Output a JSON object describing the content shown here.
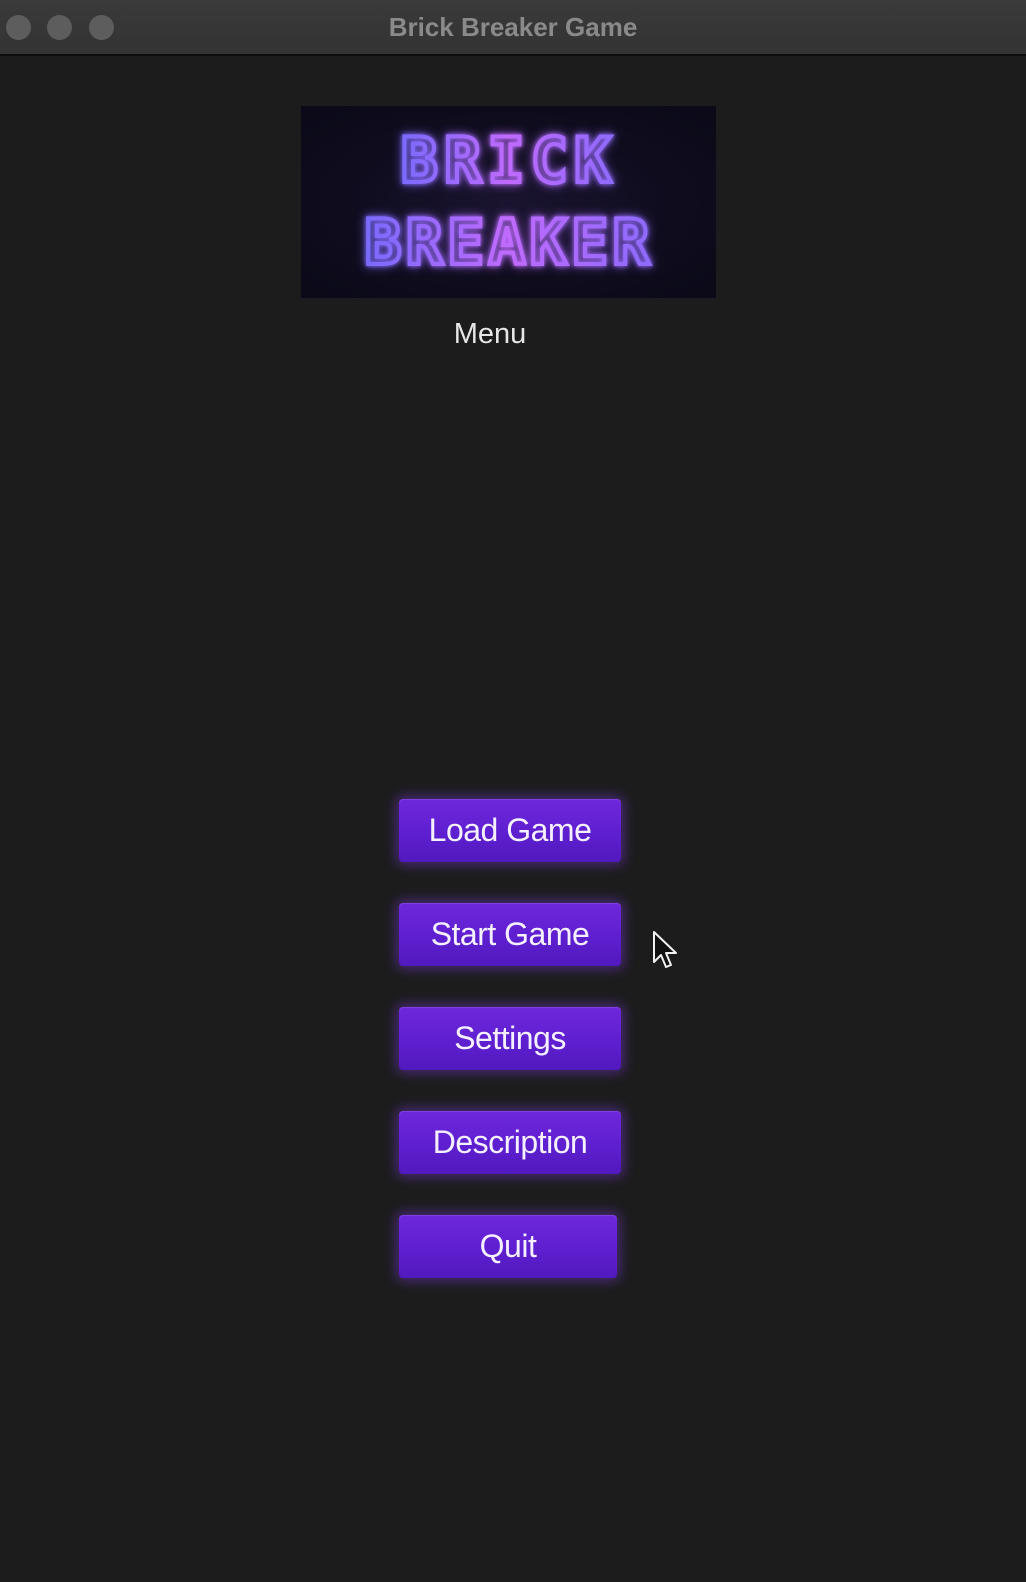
{
  "window": {
    "title": "Brick Breaker Game",
    "controls": [
      "close",
      "minimize",
      "zoom"
    ]
  },
  "logo": {
    "line1": "BRICK",
    "line2": "BREAKER",
    "glow_color": "#b35cff",
    "outline_color": "#6a5cff"
  },
  "menu": {
    "label": "Menu",
    "buttons": [
      {
        "label": "Load Game"
      },
      {
        "label": "Start Game"
      },
      {
        "label": "Settings"
      },
      {
        "label": "Description"
      },
      {
        "label": "Quit"
      }
    ]
  },
  "colors": {
    "background": "#1c1c1c",
    "button": "#5e1fd0",
    "button_text": "#f4f0ff"
  },
  "cursor": {
    "icon": "mouse-pointer-icon"
  }
}
